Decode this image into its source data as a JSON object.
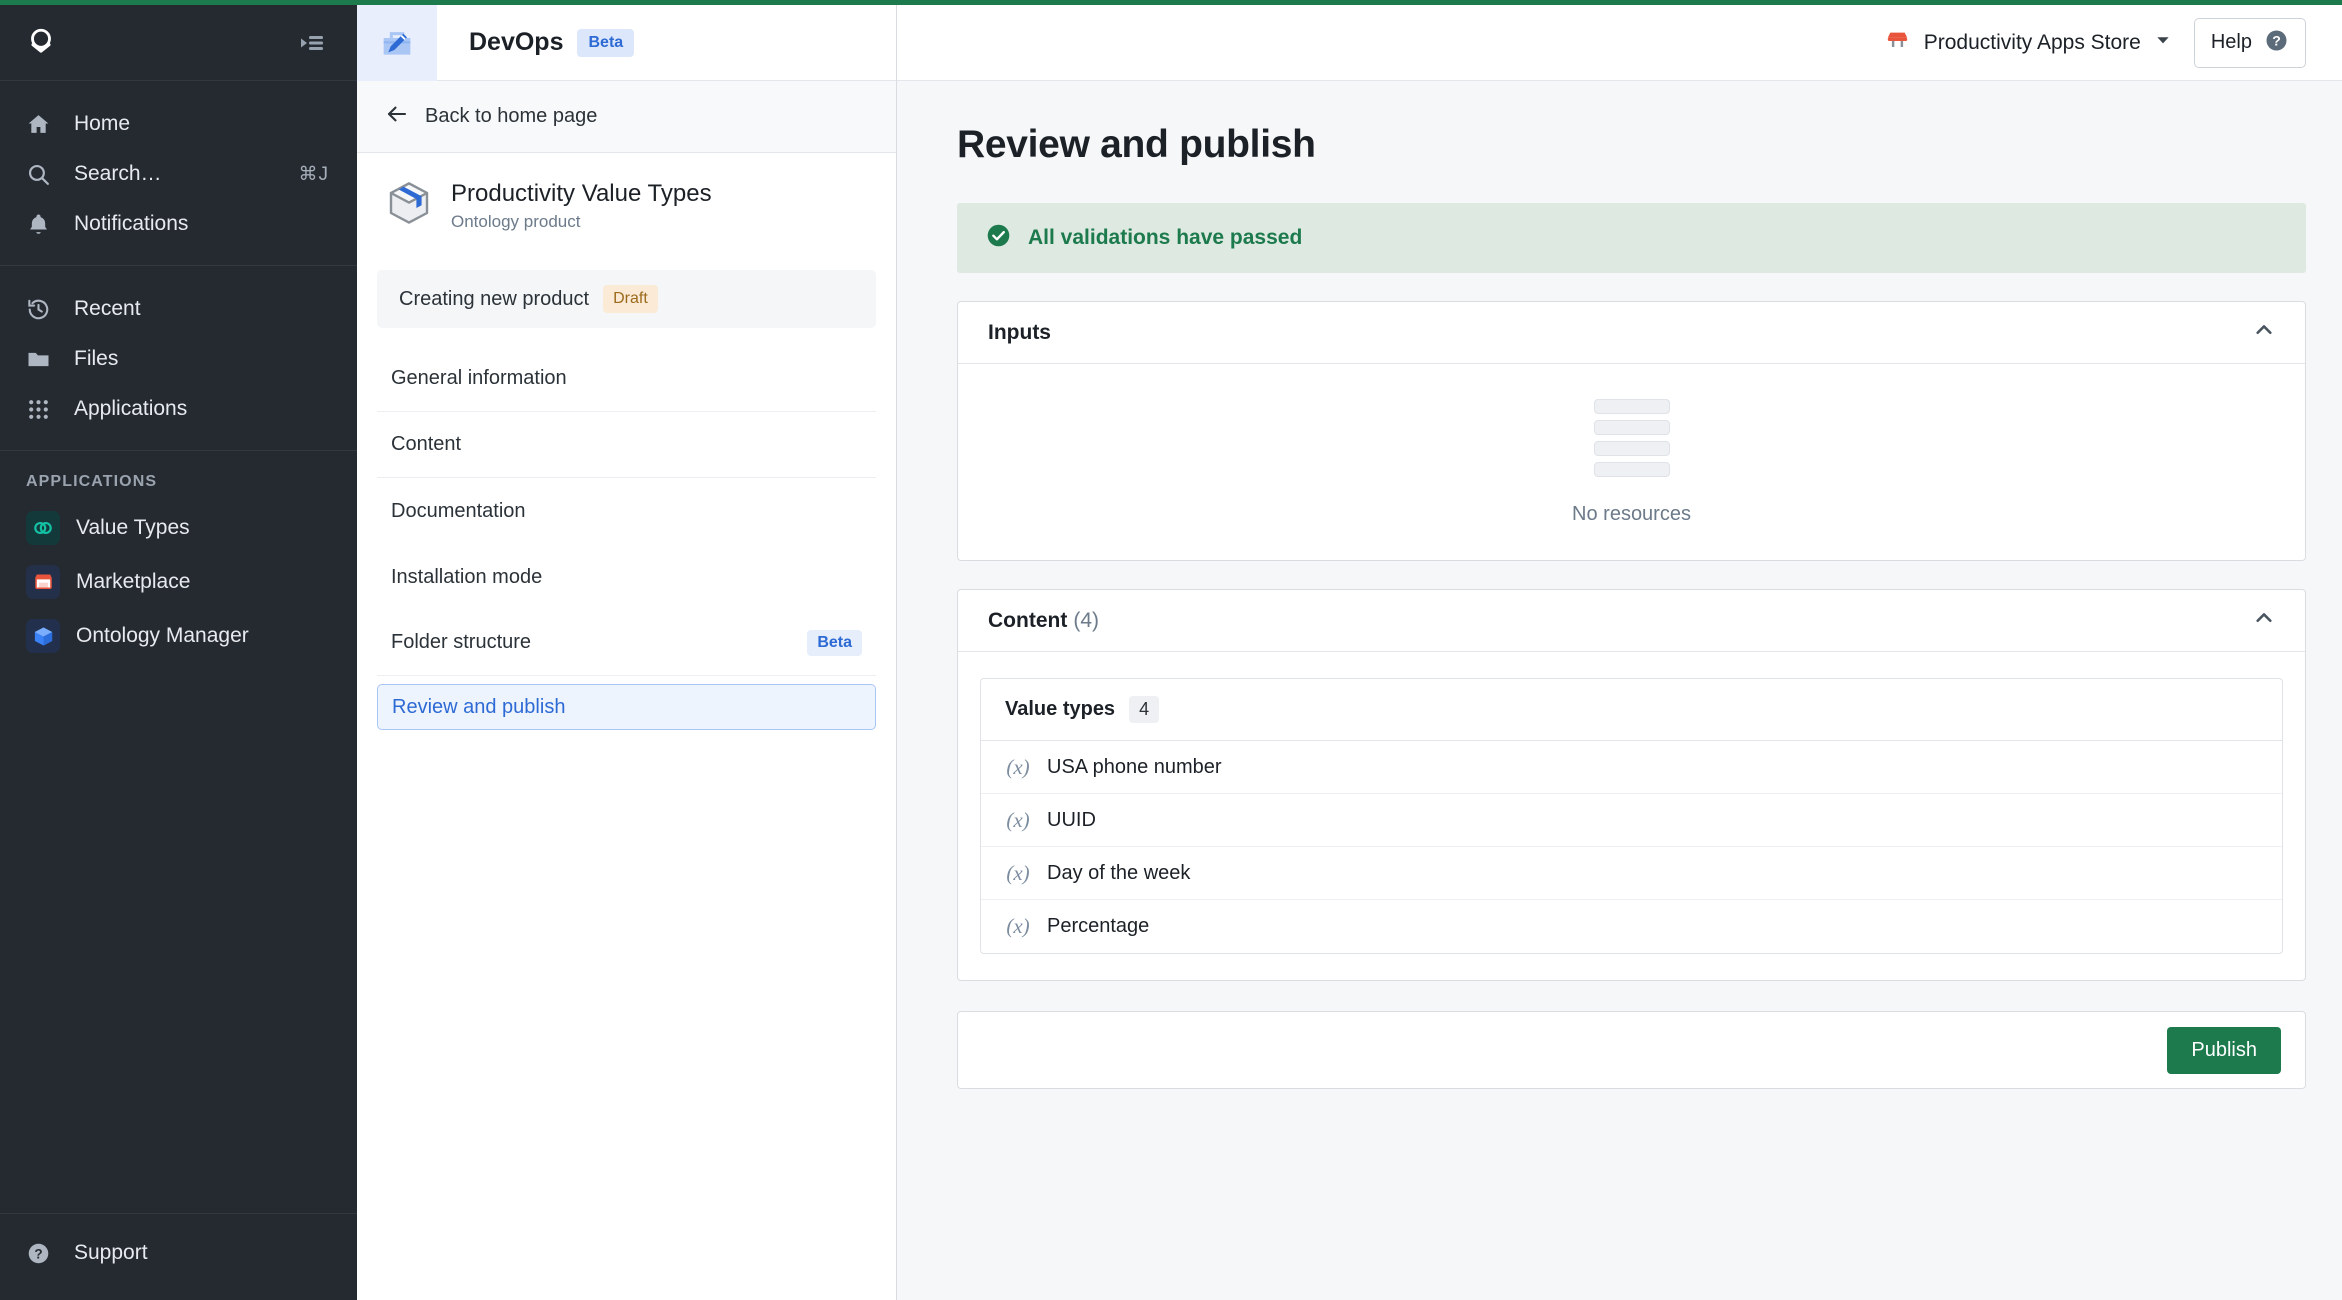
{
  "accent": {
    "green": "#1c7a4d",
    "blue": "#2d6ad4",
    "draft_amber": "#9c6a1c"
  },
  "sidebar": {
    "logo_icon": "palantir-o-logo-icon",
    "collapse_icon": "collapse-panel-icon",
    "primary": [
      {
        "label": "Home",
        "icon": "home-icon",
        "shortcut": ""
      },
      {
        "label": "Search…",
        "icon": "search-icon",
        "shortcut": "⌘J"
      },
      {
        "label": "Notifications",
        "icon": "bell-icon",
        "shortcut": ""
      }
    ],
    "secondary": [
      {
        "label": "Recent",
        "icon": "history-clock-icon"
      },
      {
        "label": "Files",
        "icon": "folder-icon"
      },
      {
        "label": "Applications",
        "icon": "grid-dots-icon"
      }
    ],
    "section_title": "APPLICATIONS",
    "applications": [
      {
        "label": "Value Types",
        "icon": "value-types-icon"
      },
      {
        "label": "Marketplace",
        "icon": "marketplace-storefront-icon"
      },
      {
        "label": "Ontology Manager",
        "icon": "ontology-cube-icon"
      }
    ],
    "support": {
      "label": "Support",
      "icon": "help-circle-icon"
    }
  },
  "app_header": {
    "icon": "devops-toolbox-icon",
    "title": "DevOps",
    "badge": "Beta"
  },
  "top_right": {
    "store_icon": "storefront-icon",
    "store_name": "Productivity Apps Store",
    "chevron_icon": "chevron-down-icon",
    "help_label": "Help",
    "help_icon": "help-circle-icon"
  },
  "left_panel": {
    "back": {
      "label": "Back to home page",
      "icon": "arrow-left-icon"
    },
    "product": {
      "icon": "product-box-icon",
      "name": "Productivity Value Types",
      "subtitle": "Ontology product"
    },
    "status": {
      "label": "Creating new product",
      "badge": "Draft"
    },
    "nav": [
      {
        "label": "General information",
        "badge": "",
        "active": false,
        "divider": true
      },
      {
        "label": "Content",
        "badge": "",
        "active": false,
        "divider": true
      },
      {
        "label": "Documentation",
        "badge": "",
        "active": false,
        "divider": false
      },
      {
        "label": "Installation mode",
        "badge": "",
        "active": false,
        "divider": false
      },
      {
        "label": "Folder structure",
        "badge": "Beta",
        "active": false,
        "divider": true
      },
      {
        "label": "Review and publish",
        "badge": "",
        "active": true,
        "divider": false
      }
    ]
  },
  "main": {
    "page_title": "Review and publish",
    "validation": {
      "icon": "check-circle-icon",
      "text": "All validations have passed"
    },
    "inputs_card": {
      "title": "Inputs",
      "collapse_icon": "chevron-up-icon",
      "empty_icon": "stacked-bars-icon",
      "empty_text": "No resources"
    },
    "content_card": {
      "title": "Content",
      "count": "(4)",
      "collapse_icon": "chevron-up-icon",
      "group": {
        "title": "Value types",
        "count": "4",
        "rows": [
          {
            "icon": "value-expression-icon",
            "name": "USA phone number"
          },
          {
            "icon": "value-expression-icon",
            "name": "UUID"
          },
          {
            "icon": "value-expression-icon",
            "name": "Day of the week"
          },
          {
            "icon": "value-expression-icon",
            "name": "Percentage"
          }
        ]
      }
    },
    "publish_label": "Publish"
  }
}
